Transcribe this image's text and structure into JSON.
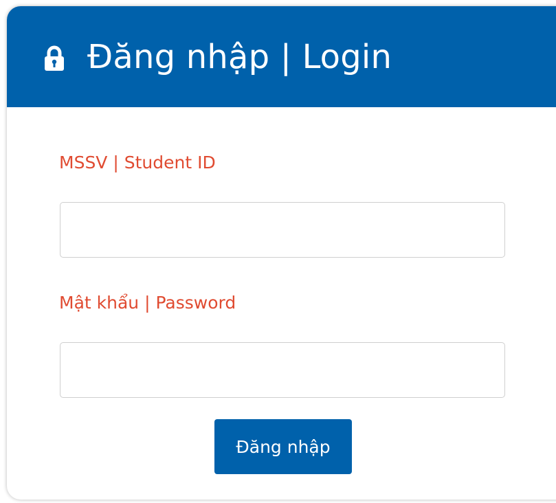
{
  "header": {
    "icon": "lock-icon",
    "title": "Đăng nhập | Login"
  },
  "form": {
    "student_id_label": "MSSV | Student ID",
    "student_id_value": "",
    "password_label": "Mật khẩu | Password",
    "password_value": "",
    "submit_label": "Đăng nhập"
  },
  "colors": {
    "header_bg": "#0061ab",
    "label_text": "#e04b31",
    "button_bg": "#0061ab"
  }
}
